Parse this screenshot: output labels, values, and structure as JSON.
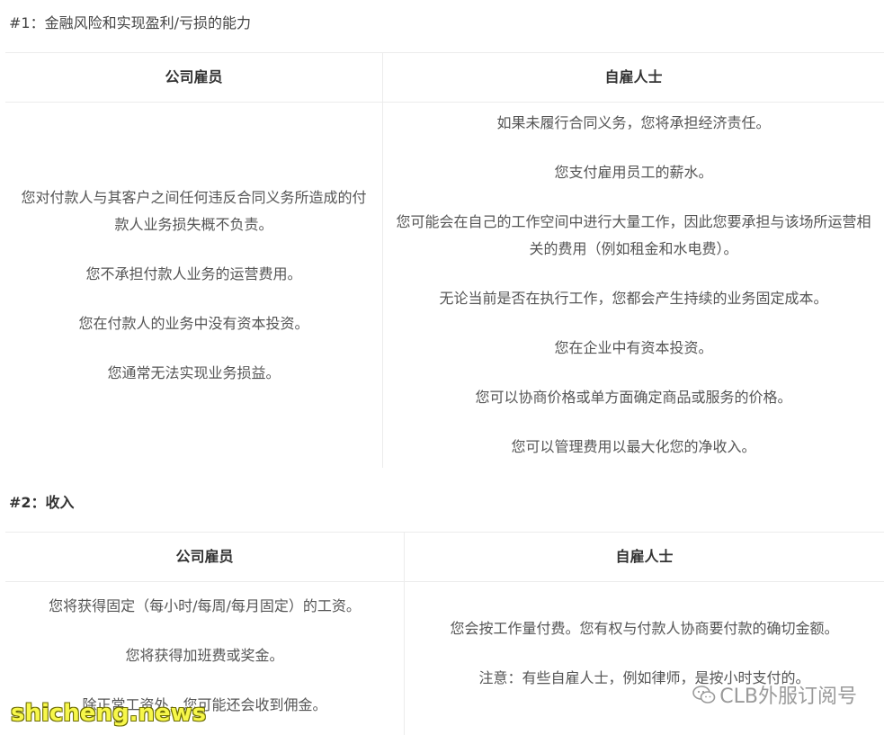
{
  "sections": [
    {
      "heading": "#1：金融风险和实现盈利/亏损的能力",
      "columns": [
        "公司雇员",
        "自雇人士"
      ],
      "left_rows": [
        "您对付款人与其客户之间任何违反合同义务所造成的付款人业务损失概不负责。",
        "您不承担付款人业务的运营费用。",
        "您在付款人的业务中没有资本投资。",
        "您通常无法实现业务损益。"
      ],
      "right_rows": [
        "如果未履行合同义务，您将承担经济责任。",
        "您支付雇用员工的薪水。",
        "您可能会在自己的工作空间中进行大量工作，因此您要承担与该场所运营相关的费用（例如租金和水电费）。",
        "无论当前是否在执行工作，您都会产生持续的业务固定成本。",
        "您在企业中有资本投资。",
        "您可以协商价格或单方面确定商品或服务的价格。",
        "您可以管理费用以最大化您的净收入。"
      ]
    },
    {
      "heading": "#2：收入",
      "columns": [
        "公司雇员",
        "自雇人士"
      ],
      "left_rows": [
        "您将获得固定（每小时/每周/每月固定）的工资。",
        "您将获得加班费或奖金。",
        "除正常工资外，您可能还会收到佣金。"
      ],
      "right_rows": [
        "您会按工作量付费。您有权与付款人协商要付款的确切金额。",
        "注意：有些自雇人士，例如律师，是按小时支付的。"
      ]
    }
  ],
  "watermarks": {
    "wechat": "CLB外服订阅号",
    "site": "shicheng.news"
  },
  "icons": {
    "wechat_icon": "wechat-chat-bubbles"
  }
}
